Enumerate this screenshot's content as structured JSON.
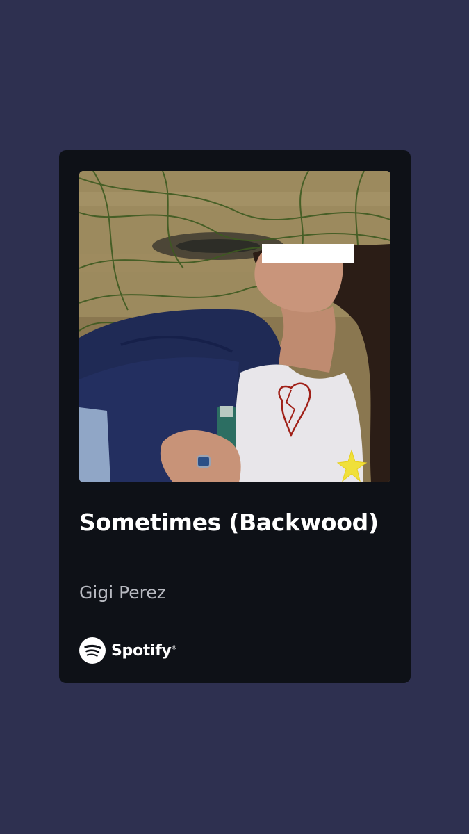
{
  "share_card": {
    "background_color": "#2e3050",
    "card_color": "#0e1117",
    "cover": {
      "icon": "album-cover-image"
    },
    "track_title": "Sometimes (Backwood)",
    "artist_name": "Gigi Perez",
    "brand": {
      "icon": "spotify-logo-icon",
      "name": "Spotify",
      "mark": "®"
    }
  }
}
